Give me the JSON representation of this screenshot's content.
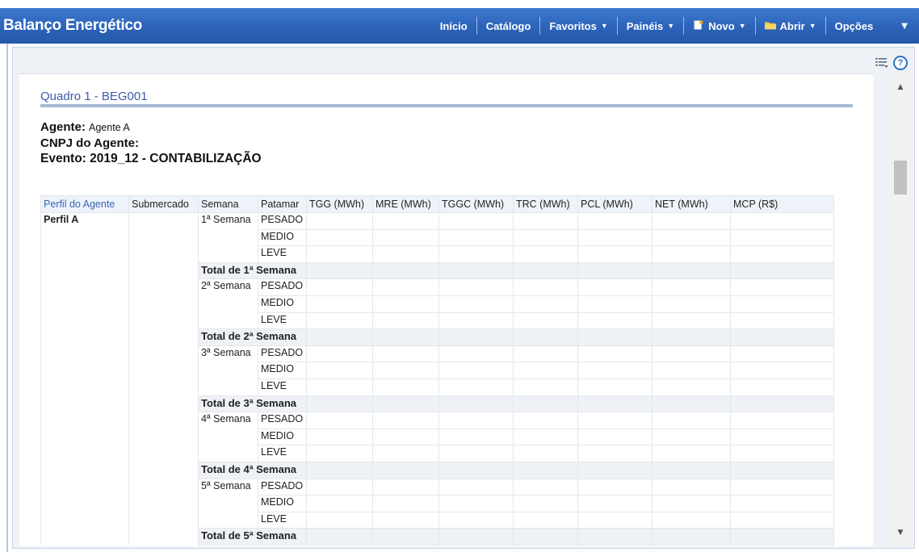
{
  "header": {
    "title": "Balanço Energético",
    "nav": [
      {
        "label": "Início",
        "dropdown": false,
        "icon": ""
      },
      {
        "label": "Catálogo",
        "dropdown": false,
        "icon": ""
      },
      {
        "label": "Favoritos",
        "dropdown": true,
        "icon": ""
      },
      {
        "label": "Painéis",
        "dropdown": true,
        "icon": ""
      },
      {
        "label": "Novo",
        "dropdown": true,
        "icon": "new-document-icon"
      },
      {
        "label": "Abrir",
        "dropdown": true,
        "icon": "folder-icon"
      },
      {
        "label": "Opções",
        "dropdown": false,
        "icon": ""
      }
    ]
  },
  "toolbar": {
    "help_label": "?"
  },
  "report": {
    "title": "Quadro 1 - BEG001",
    "agente_label": "Agente:",
    "agente_value": "Agente A",
    "cnpj_label": "CNPJ do Agente:",
    "evento_label": "Evento: 2019_12 - CONTABILIZAÇÃO"
  },
  "table": {
    "columns": [
      "Perfil do Agente",
      "Submercado",
      "Semana",
      "Patamar",
      "TGG (MWh)",
      "MRE (MWh)",
      "TGGC (MWh)",
      "TRC (MWh)",
      "PCL (MWh)",
      "NET (MWh)",
      "MCP (R$)"
    ],
    "perfil": "Perfil A",
    "submercado": "",
    "weeks": [
      {
        "label": "1ª Semana",
        "patamares": [
          "PESADO",
          "MEDIO",
          "LEVE"
        ],
        "total": "Total de 1ª Semana"
      },
      {
        "label": "2ª Semana",
        "patamares": [
          "PESADO",
          "MEDIO",
          "LEVE"
        ],
        "total": "Total de 2ª Semana"
      },
      {
        "label": "3ª Semana",
        "patamares": [
          "PESADO",
          "MEDIO",
          "LEVE"
        ],
        "total": "Total de 3ª Semana"
      },
      {
        "label": "4ª Semana",
        "patamares": [
          "PESADO",
          "MEDIO",
          "LEVE"
        ],
        "total": "Total de 4ª Semana"
      },
      {
        "label": "5ª Semana",
        "patamares": [
          "PESADO",
          "MEDIO",
          "LEVE"
        ],
        "total": "Total de 5ª Semana"
      }
    ]
  },
  "colors": {
    "header": "#2c63b9",
    "title": "#3c5ca8",
    "link": "#3a66b0"
  }
}
